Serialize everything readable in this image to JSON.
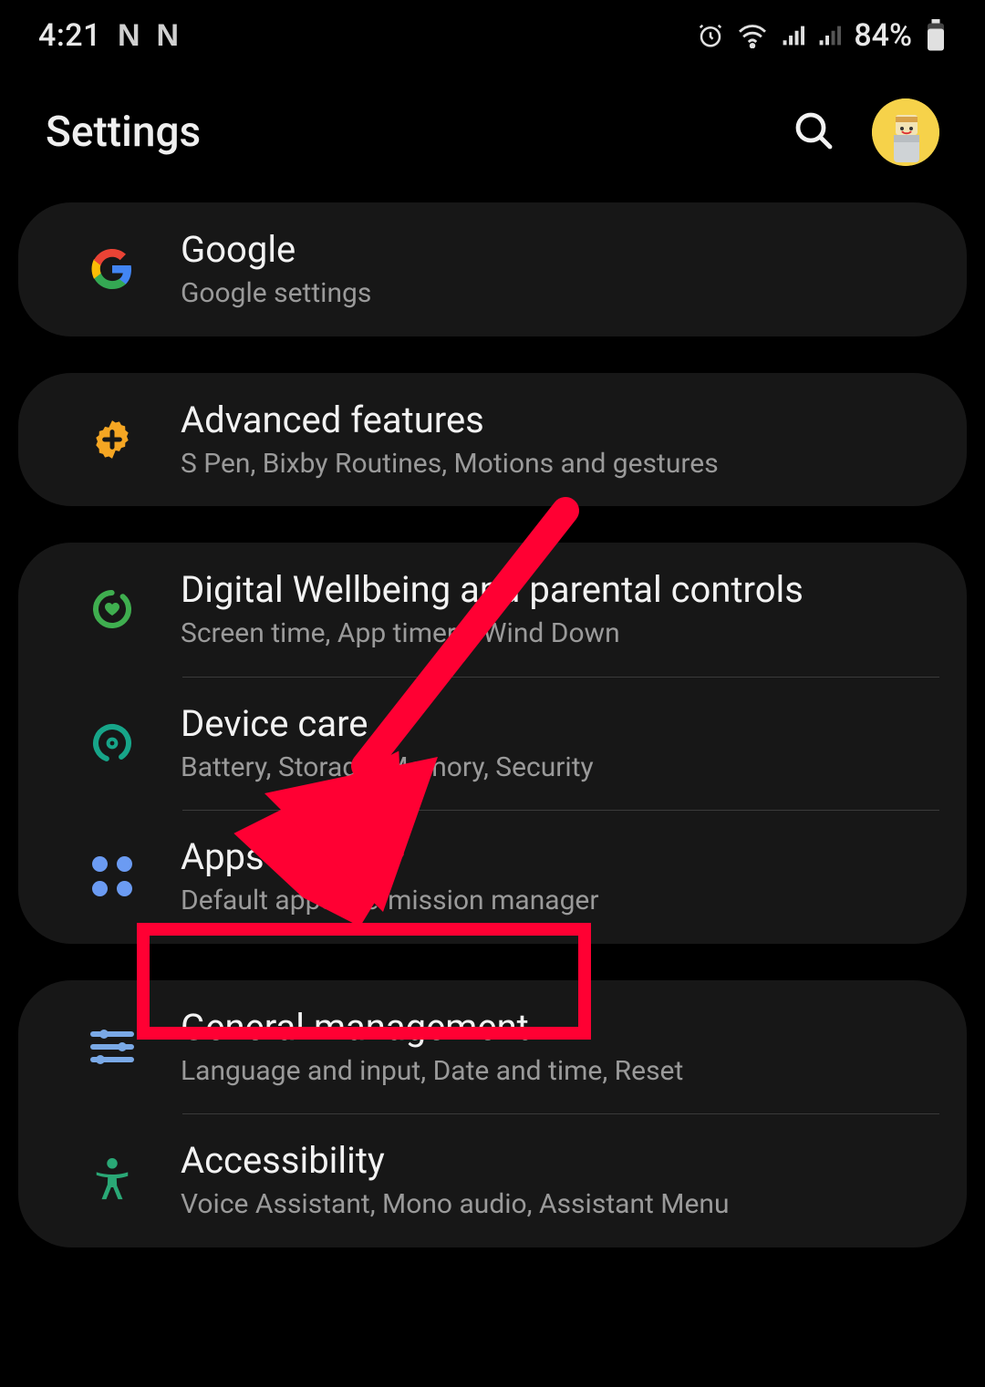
{
  "statusbar": {
    "time": "4:21",
    "notif1": "N",
    "notif2": "N",
    "battery_pct": "84%"
  },
  "header": {
    "title": "Settings"
  },
  "groups": [
    {
      "rows": [
        {
          "id": "google",
          "label": "Google",
          "sub": "Google settings"
        }
      ]
    },
    {
      "rows": [
        {
          "id": "advanced",
          "label": "Advanced features",
          "sub": "S Pen, Bixby Routines, Motions and gestures"
        }
      ]
    },
    {
      "rows": [
        {
          "id": "wellbeing",
          "label": "Digital Wellbeing and parental controls",
          "sub": "Screen time, App timers, Wind Down"
        },
        {
          "id": "devicecare",
          "label": "Device care",
          "sub": "Battery, Storage, Memory, Security"
        },
        {
          "id": "apps",
          "label": "Apps",
          "sub": "Default apps, Permission manager"
        }
      ]
    },
    {
      "rows": [
        {
          "id": "general",
          "label": "General management",
          "sub": "Language and input, Date and time, Reset"
        },
        {
          "id": "accessibility",
          "label": "Accessibility",
          "sub": "Voice Assistant, Mono audio, Assistant Menu"
        }
      ]
    }
  ],
  "annotation": {
    "target": "general-management"
  }
}
